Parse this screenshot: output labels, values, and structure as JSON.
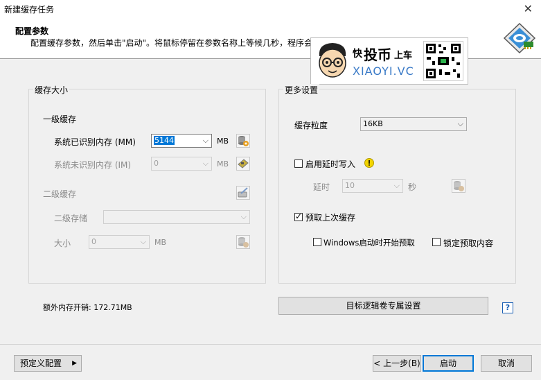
{
  "window": {
    "title": "新建缓存任务"
  },
  "header": {
    "title": "配置参数",
    "description": "配置缓存参数，然后单击\"启动\"。将鼠标停留在参数名称上等候几秒，程序会显示该参数的相关说明。"
  },
  "ad": {
    "brand_a": "快",
    "brand_b": "投币",
    "brand_c": "上车",
    "site": "XIAOYI.VC"
  },
  "cache_size": {
    "group_title": "缓存大小",
    "level1_title": "一级缓存",
    "recognized_label": "系统已识别内存 (MM)",
    "recognized_value": "5144",
    "recognized_unit": "MB",
    "unrecognized_label": "系统未识别内存 (IM)",
    "unrecognized_value": "0",
    "unrecognized_unit": "MB",
    "level2_title": "二级缓存",
    "storage_label": "二级存储",
    "storage_value": "",
    "size_label": "大小",
    "size_value": "0",
    "size_unit": "MB"
  },
  "extra_memory": "额外内存开销: 172.71MB",
  "more": {
    "group_title": "更多设置",
    "granularity_label": "缓存粒度",
    "granularity_value": "16KB",
    "delay_write_label": "启用延时写入",
    "delay_write_checked": false,
    "delay_label": "延时",
    "delay_value": "10",
    "delay_unit": "秒",
    "prefetch_label": "预取上次缓存",
    "prefetch_checked": true,
    "prefetch_on_start_label": "Windows启动时开始预取",
    "lock_prefetch_label": "锁定预取内容"
  },
  "volume_button": "目标逻辑卷专属设置",
  "help_icon_text": "?",
  "footer": {
    "preset_label": "预定义配置",
    "back_label": "< 上一步(B)",
    "start_label": "启动",
    "cancel_label": "取消"
  },
  "colors": {
    "accent": "#0078d7",
    "help": "#1a5fb4",
    "warning": "#e8c800"
  }
}
